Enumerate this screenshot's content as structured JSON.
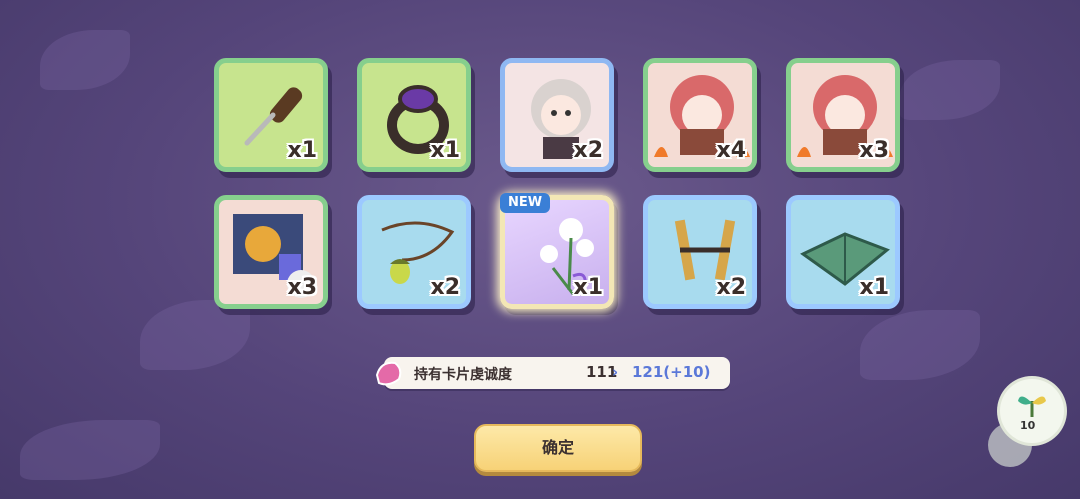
{
  "items": [
    {
      "name": "screwdriver",
      "qty": "x1",
      "style": "green"
    },
    {
      "name": "gem-ring",
      "qty": "x1",
      "style": "green"
    },
    {
      "name": "girl-character-card",
      "qty": "x2",
      "style": "charblue"
    },
    {
      "name": "reading-girl-card",
      "qty": "x4",
      "style": "char"
    },
    {
      "name": "reading-girl-card",
      "qty": "x3",
      "style": "char"
    },
    {
      "name": "treasure-poster-card",
      "qty": "x3",
      "style": "char"
    },
    {
      "name": "acorn-necklace",
      "qty": "x2",
      "style": "blue"
    },
    {
      "name": "flower-bouquet",
      "qty": "x1",
      "style": "purple",
      "is_new": true
    },
    {
      "name": "wooden-slingshot",
      "qty": "x2",
      "style": "blue"
    },
    {
      "name": "green-book",
      "qty": "x1",
      "style": "blue"
    }
  ],
  "new_badge": "NEW",
  "stat": {
    "label": "持有卡片虔诚度",
    "old_value": "111",
    "arrow": "›",
    "new_value": "121(+10)"
  },
  "confirm_label": "确定",
  "side_bubble": {
    "count": "10"
  },
  "colors": {
    "background": "#55457a",
    "accent": "#5b78d8",
    "button": "#f7d277"
  }
}
